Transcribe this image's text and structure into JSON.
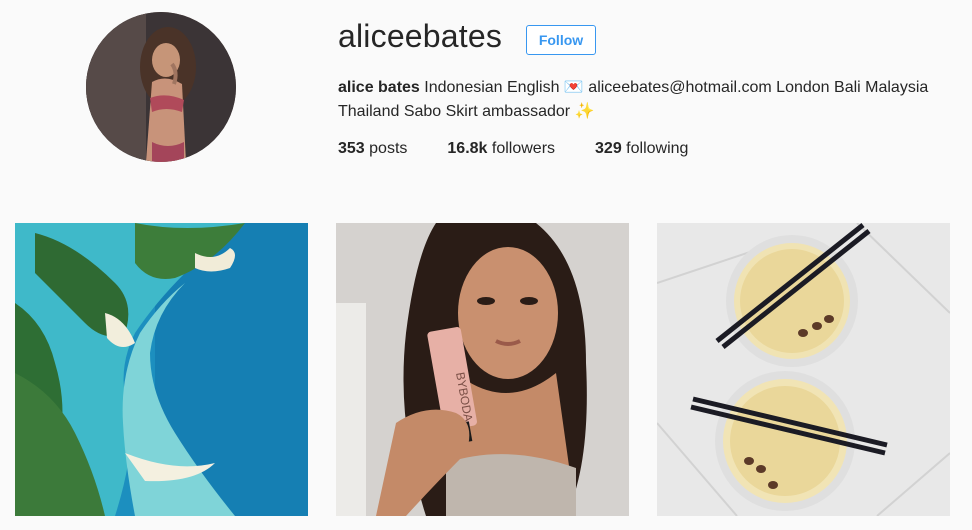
{
  "profile": {
    "username": "aliceebates",
    "follow_label": "Follow",
    "bio_name": "alice bates",
    "bio_line1_rest": " Indonesian English 💌 aliceebates@hotmail.com London Bali Malaysia",
    "bio_line2": "Thailand Sabo Skirt ambassador ✨"
  },
  "stats": {
    "posts_count": "353",
    "posts_label": " posts",
    "followers_count": "16.8k",
    "followers_label": " followers",
    "following_count": "329",
    "following_label": " following"
  },
  "posts": [
    {
      "name": "aerial-island-photo"
    },
    {
      "name": "selfie-with-product-photo",
      "product_text": "BYBODA"
    },
    {
      "name": "coffee-drinks-photo"
    }
  ],
  "colors": {
    "follow_blue": "#3897f0",
    "text": "#262626",
    "background": "#fafafa"
  }
}
